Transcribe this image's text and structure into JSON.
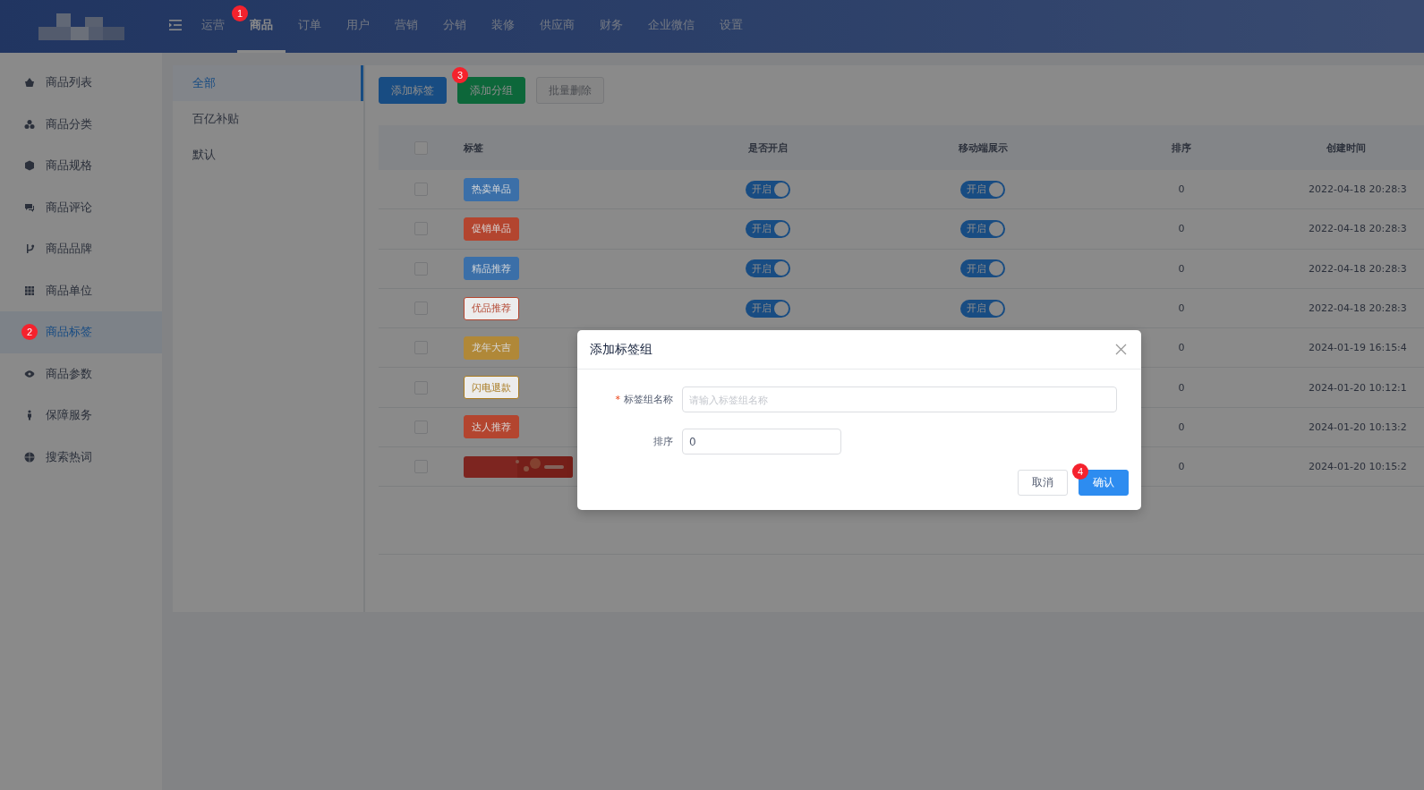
{
  "top_nav": {
    "items": [
      {
        "label": "运营",
        "selected": false
      },
      {
        "label": "商品",
        "selected": true,
        "badge": "1"
      },
      {
        "label": "订单",
        "selected": false
      },
      {
        "label": "用户",
        "selected": false
      },
      {
        "label": "营销",
        "selected": false
      },
      {
        "label": "分销",
        "selected": false
      },
      {
        "label": "装修",
        "selected": false
      },
      {
        "label": "供应商",
        "selected": false
      },
      {
        "label": "财务",
        "selected": false
      },
      {
        "label": "企业微信",
        "selected": false
      },
      {
        "label": "设置",
        "selected": false
      }
    ]
  },
  "sidebar": {
    "items": [
      {
        "label": "商品列表",
        "selected": false
      },
      {
        "label": "商品分类",
        "selected": false
      },
      {
        "label": "商品规格",
        "selected": false
      },
      {
        "label": "商品评论",
        "selected": false
      },
      {
        "label": "商品品牌",
        "selected": false
      },
      {
        "label": "商品单位",
        "selected": false
      },
      {
        "label": "商品标签",
        "selected": true,
        "badge": "2"
      },
      {
        "label": "商品参数",
        "selected": false
      },
      {
        "label": "保障服务",
        "selected": false
      },
      {
        "label": "搜索热词",
        "selected": false
      }
    ]
  },
  "groups": {
    "items": [
      {
        "label": "全部",
        "selected": true
      },
      {
        "label": "百亿补贴",
        "selected": false
      },
      {
        "label": "默认",
        "selected": false
      }
    ]
  },
  "toolbar": {
    "buttons": [
      {
        "label": "添加标签",
        "kind": "primary"
      },
      {
        "label": "添加分组",
        "kind": "success",
        "badge": "3"
      },
      {
        "label": "批量删除",
        "kind": "disabled"
      }
    ]
  },
  "table": {
    "columns": [
      "标签",
      "是否开启",
      "移动端展示",
      "排序",
      "创建时间"
    ],
    "header_checked": false,
    "rows": [
      {
        "checked": false,
        "tag": {
          "label": "热卖单品",
          "kind": "filled",
          "color": "#3b6fa8"
        },
        "enabled": {
          "on": true,
          "label": "开启"
        },
        "mobile": {
          "on": true,
          "label": "开启"
        },
        "sort": "0",
        "created": "2022-04-18 20:28:3"
      },
      {
        "checked": false,
        "tag": {
          "label": "促销单品",
          "kind": "filled",
          "color": "#b3452f"
        },
        "enabled": {
          "on": true,
          "label": "开启"
        },
        "mobile": {
          "on": true,
          "label": "开启"
        },
        "sort": "0",
        "created": "2022-04-18 20:28:3"
      },
      {
        "checked": false,
        "tag": {
          "label": "精品推荐",
          "kind": "filled",
          "color": "#3b6fa8"
        },
        "enabled": {
          "on": true,
          "label": "开启"
        },
        "mobile": {
          "on": true,
          "label": "开启"
        },
        "sort": "0",
        "created": "2022-04-18 20:28:3"
      },
      {
        "checked": false,
        "tag": {
          "label": "优品推荐",
          "kind": "outline",
          "color": "#b3452f"
        },
        "enabled": {
          "on": true,
          "label": "开启"
        },
        "mobile": {
          "on": true,
          "label": "开启"
        },
        "sort": "0",
        "created": "2022-04-18 20:28:3"
      },
      {
        "checked": false,
        "tag": {
          "label": "龙年大吉",
          "kind": "filled",
          "color": "#b08838"
        },
        "sort": "0",
        "created": "2024-01-19 16:15:4"
      },
      {
        "checked": false,
        "tag": {
          "label": "闪电退款",
          "kind": "outline",
          "color": "#a87a20"
        },
        "sort": "0",
        "created": "2024-01-20 10:12:1"
      },
      {
        "checked": false,
        "tag": {
          "label": "达人推荐",
          "kind": "filled",
          "color": "#b3452f"
        },
        "sort": "0",
        "created": "2024-01-20 10:13:2"
      },
      {
        "checked": false,
        "sort": "0",
        "created": "2024-01-20 10:15:2"
      }
    ]
  },
  "dialog": {
    "title": "添加标签组",
    "fields": [
      {
        "label": "标签组名称",
        "required_mark": "*",
        "placeholder": "请输入标签组名称",
        "wide": true
      },
      {
        "label": "排序",
        "value": "0",
        "wide": false
      }
    ],
    "buttons": [
      {
        "label": "取消",
        "kind": "default"
      },
      {
        "label": "确认",
        "kind": "primary",
        "badge": "4"
      }
    ]
  }
}
